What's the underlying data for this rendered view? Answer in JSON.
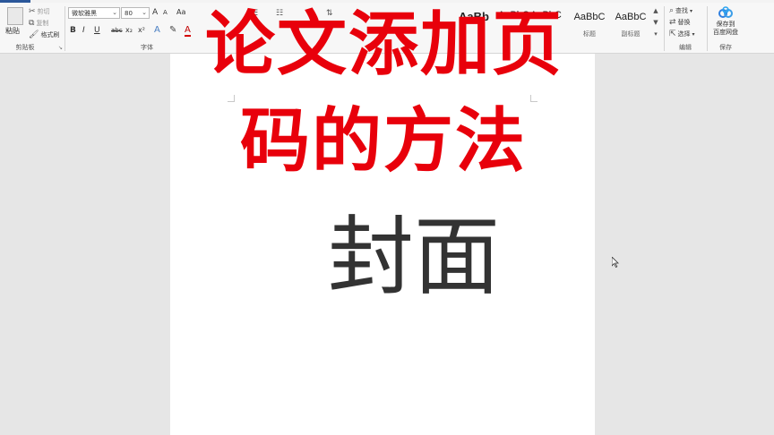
{
  "ribbon": {
    "clipboard": {
      "paste": "粘贴",
      "cut": "剪切",
      "copy": "复制",
      "format_painter": "格式刷",
      "label": "剪贴板"
    },
    "font": {
      "font_name": "微软雅黑",
      "font_size": "80",
      "grow": "A",
      "shrink": "A",
      "change_case": "Aa",
      "clear_format": "A",
      "bold": "B",
      "italic": "I",
      "underline": "U",
      "strike": "abc",
      "subscript": "x₂",
      "superscript": "x²",
      "font_color": "A",
      "label": "字体"
    },
    "styles": {
      "tiles": [
        {
          "sample": "AaBbC",
          "name": "标题"
        },
        {
          "sample": "AaBbC",
          "name": "副标题"
        }
      ]
    },
    "editing": {
      "find": "查找",
      "replace": "替换",
      "select": "选择",
      "label": "编辑"
    },
    "save": {
      "line1": "保存到",
      "line2": "百度网盘",
      "label": "保存"
    }
  },
  "document": {
    "cover_text": "封面"
  },
  "overlay": {
    "line1": "论文添加页",
    "line2": "码的方法"
  },
  "colors": {
    "overlay": "#e8000b",
    "accent": "#2b579a",
    "cover_text": "#333333"
  }
}
